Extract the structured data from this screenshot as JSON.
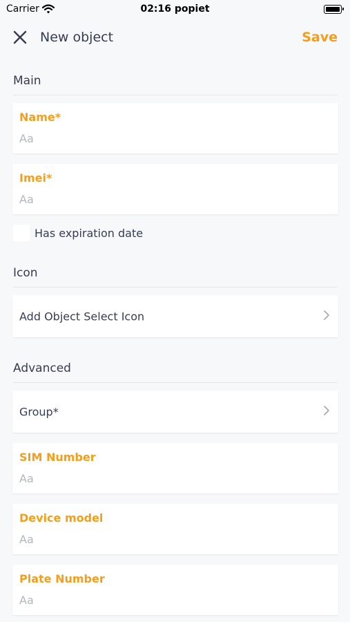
{
  "status_bar": {
    "carrier": "Carrier",
    "time": "02:16 popiet"
  },
  "nav": {
    "title": "New object",
    "save_label": "Save",
    "accent_color": "#f49e1c"
  },
  "sections": {
    "main": "Main",
    "icon": "Icon",
    "advanced": "Advanced"
  },
  "fields": {
    "name": {
      "label": "Name*",
      "placeholder": "Aa"
    },
    "imei": {
      "label": "Imei*",
      "placeholder": "Aa"
    },
    "sim_number": {
      "label": "SIM Number",
      "placeholder": "Aa"
    },
    "device_model": {
      "label": "Device model",
      "placeholder": "Aa"
    },
    "plate_number": {
      "label": "Plate Number",
      "placeholder": "Aa"
    }
  },
  "expiration": {
    "label": "Has expiration date",
    "checked": false
  },
  "rows": {
    "icon_select": "Add Object Select Icon",
    "group": "Group*"
  },
  "icons": {
    "close": "close-icon",
    "chevron": "chevron-right-icon",
    "wifi": "wifi-icon",
    "battery": "battery-icon"
  }
}
